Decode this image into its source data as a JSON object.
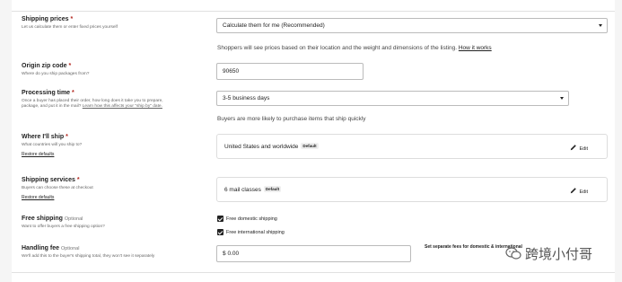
{
  "shipping_prices": {
    "label": "Shipping prices",
    "required_mark": "*",
    "sub": "Let us calculate them or enter fixed prices yourself",
    "select_value": "Calculate them for me (Recommended)",
    "help_text": "Shoppers will see prices based on their location and the weight and dimensions of the listing.",
    "help_link": "How it works"
  },
  "origin_zip": {
    "label": "Origin zip code",
    "required_mark": "*",
    "sub": "Where do you ship packages from?",
    "value": "90650"
  },
  "processing_time": {
    "label": "Processing time",
    "required_mark": "*",
    "sub": "Once a buyer has placed their order, how long does it take you to prepare, package, and put it in the mail?",
    "sub_link": "Learn how this affects your \"ship by\" date.",
    "select_value": "3-5 business days",
    "help_text": "Buyers are more likely to purchase items that ship quickly"
  },
  "where_ship": {
    "label": "Where I'll ship",
    "required_mark": "*",
    "sub": "What countries will you ship to?",
    "restore": "Restore defaults",
    "card_text": "United States and worldwide",
    "badge": "Default",
    "edit": "Edit"
  },
  "shipping_services": {
    "label": "Shipping services",
    "required_mark": "*",
    "sub": "Buyers can choose these at checkout",
    "restore": "Restore defaults",
    "card_text": "6 mail classes",
    "badge": "Default",
    "edit": "Edit"
  },
  "free_shipping": {
    "label": "Free shipping",
    "optional": "Optional",
    "sub": "Want to offer buyers a free shipping option?",
    "option1": "Free domestic shipping",
    "option1_checked": true,
    "option2": "Free international shipping",
    "option2_checked": true
  },
  "handling_fee": {
    "label": "Handling fee",
    "optional": "Optional",
    "sub": "We'll add this to the buyer's shipping total, they won't see it separately",
    "currency": "$",
    "value": "0.00",
    "separate_fees": "Set separate fees for domestic & international"
  },
  "watermark": {
    "text": "跨境小付哥",
    "icon": "wechat-icon"
  }
}
